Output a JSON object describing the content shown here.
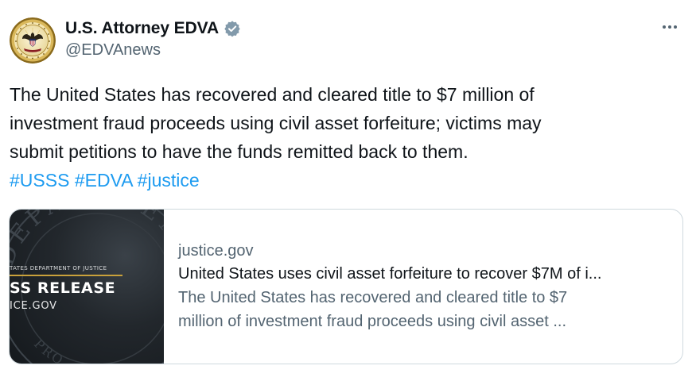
{
  "author": {
    "display_name": "U.S. Attorney EDVA",
    "handle": "@EDVAnews",
    "verified_badge_icon": "verified-badge-icon",
    "avatar_icon": "doj-seal-icon"
  },
  "menu": {
    "icon": "more-options-icon"
  },
  "tweet": {
    "lines": [
      "The United States has recovered and cleared title to $7 million of",
      "investment fraud proceeds using civil asset forfeiture; victims may",
      "submit petitions to have the funds remitted back to them."
    ],
    "hashtags": [
      "#USSS",
      "#EDVA",
      "#justice"
    ]
  },
  "card": {
    "domain": "justice.gov",
    "title": "United States uses civil asset forfeiture to recover $7M of i...",
    "description_lines": [
      "The United States has recovered and cleared title to $7",
      "million of investment fraud proceeds using civil asset ..."
    ],
    "thumbnail": {
      "small_text": "TATES DEPARTMENT OF JUSTICE",
      "big_text": "SS RELEASE",
      "site_text": "ICE.GOV"
    }
  },
  "colors": {
    "link": "#1d9bf0",
    "secondary_text": "#536471",
    "primary_text": "#0f1419",
    "border": "#cfd9de"
  }
}
